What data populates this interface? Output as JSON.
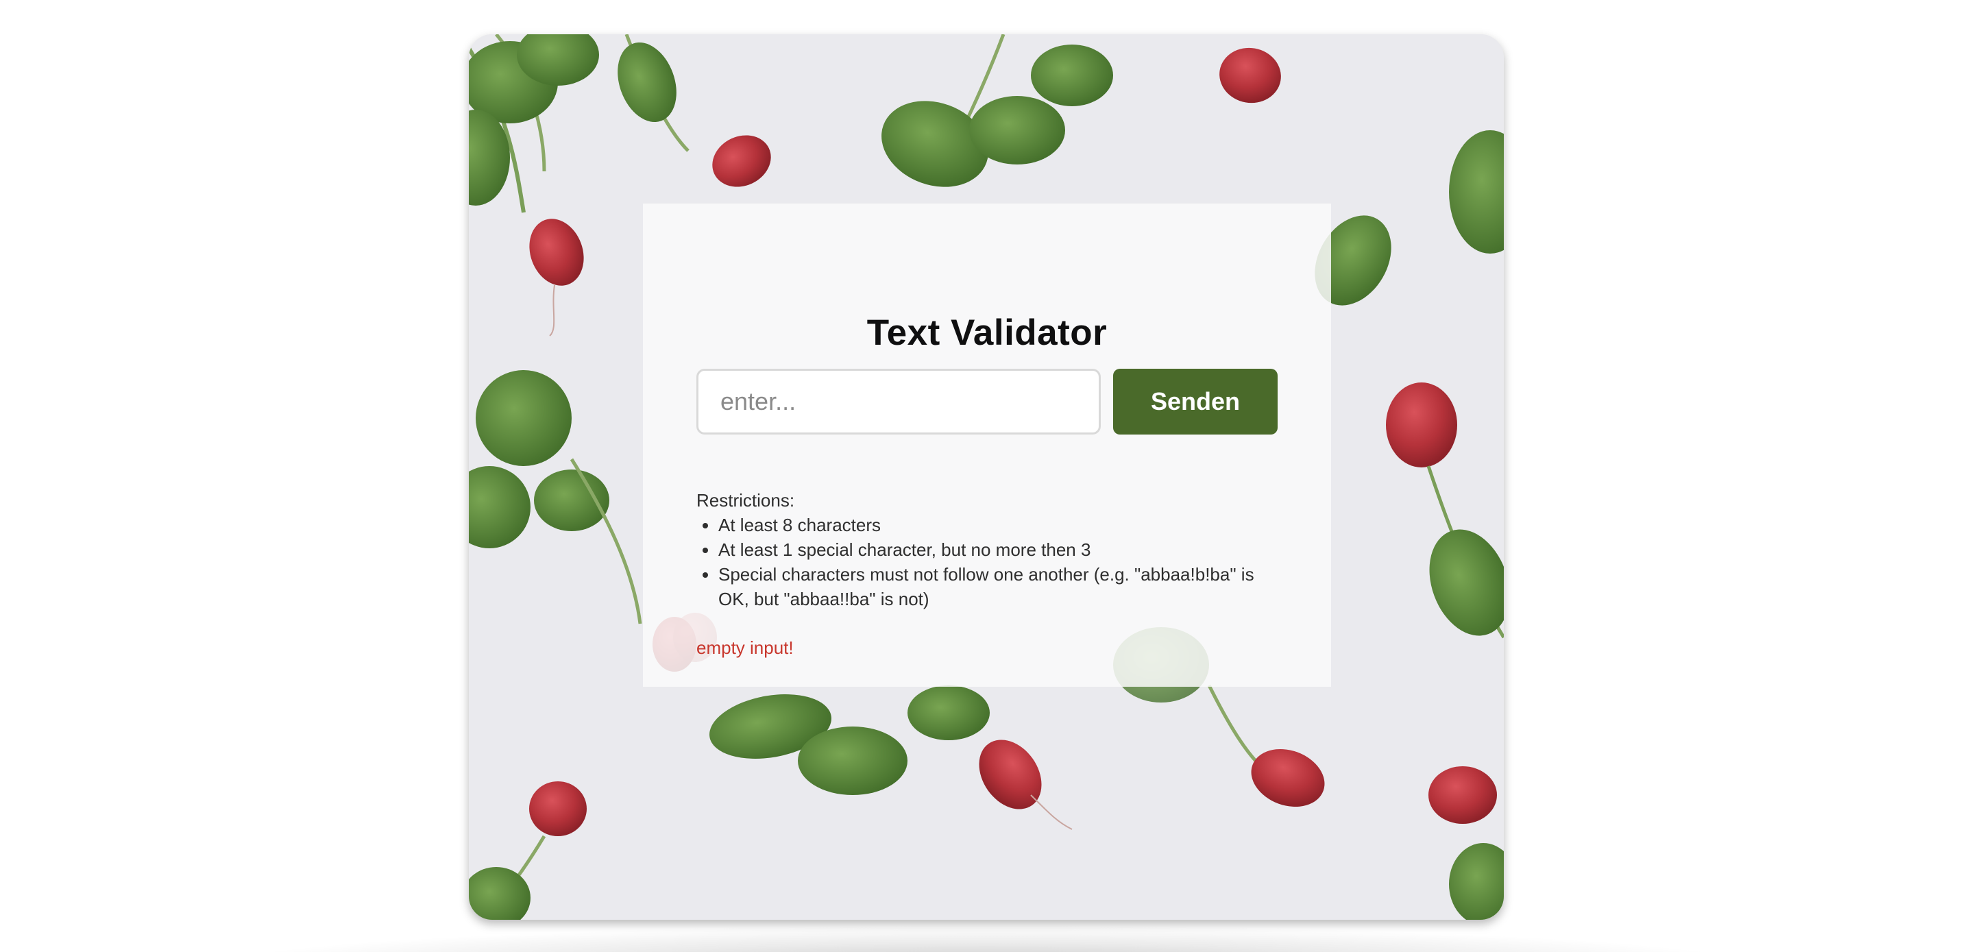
{
  "colors": {
    "accent": "#4a6a2a",
    "error": "#c8372d",
    "radish": "#b5323a",
    "leaf": "#4f7d33"
  },
  "background": {
    "image": "radish-photo"
  },
  "validator": {
    "title": "Text Validator",
    "input_placeholder": "enter...",
    "input_value": "",
    "submit_label": "Senden",
    "restrictions_heading": "Restrictions:",
    "restrictions": [
      "At least 8 characters",
      "At least 1 special character, but no more then 3",
      "Special characters must not follow one another (e.g. \"abbaa!b!ba\" is OK, but \"abbaa!!ba\" is not)"
    ],
    "error_message": "empty input!"
  }
}
